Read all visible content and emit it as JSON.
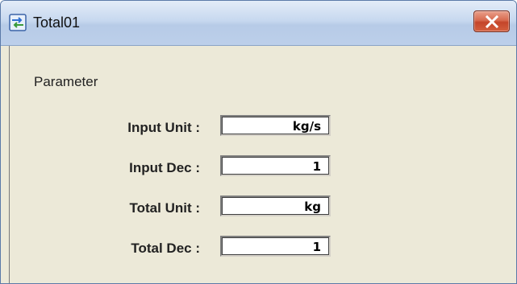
{
  "window": {
    "title": "Total01",
    "app_icon": "transfer-arrows-icon",
    "close_icon": "close-x-icon"
  },
  "section": {
    "label": "Parameter"
  },
  "rows": [
    {
      "label": "Input Unit :",
      "value": "kg/s"
    },
    {
      "label": "Input Dec :",
      "value": "1"
    },
    {
      "label": "Total Unit :",
      "value": "kg"
    },
    {
      "label": "Total Dec :",
      "value": "1"
    }
  ],
  "colors": {
    "titlebar": "#c7d8ef",
    "client_bg": "#ece9d8",
    "close_button": "#d4603f"
  }
}
